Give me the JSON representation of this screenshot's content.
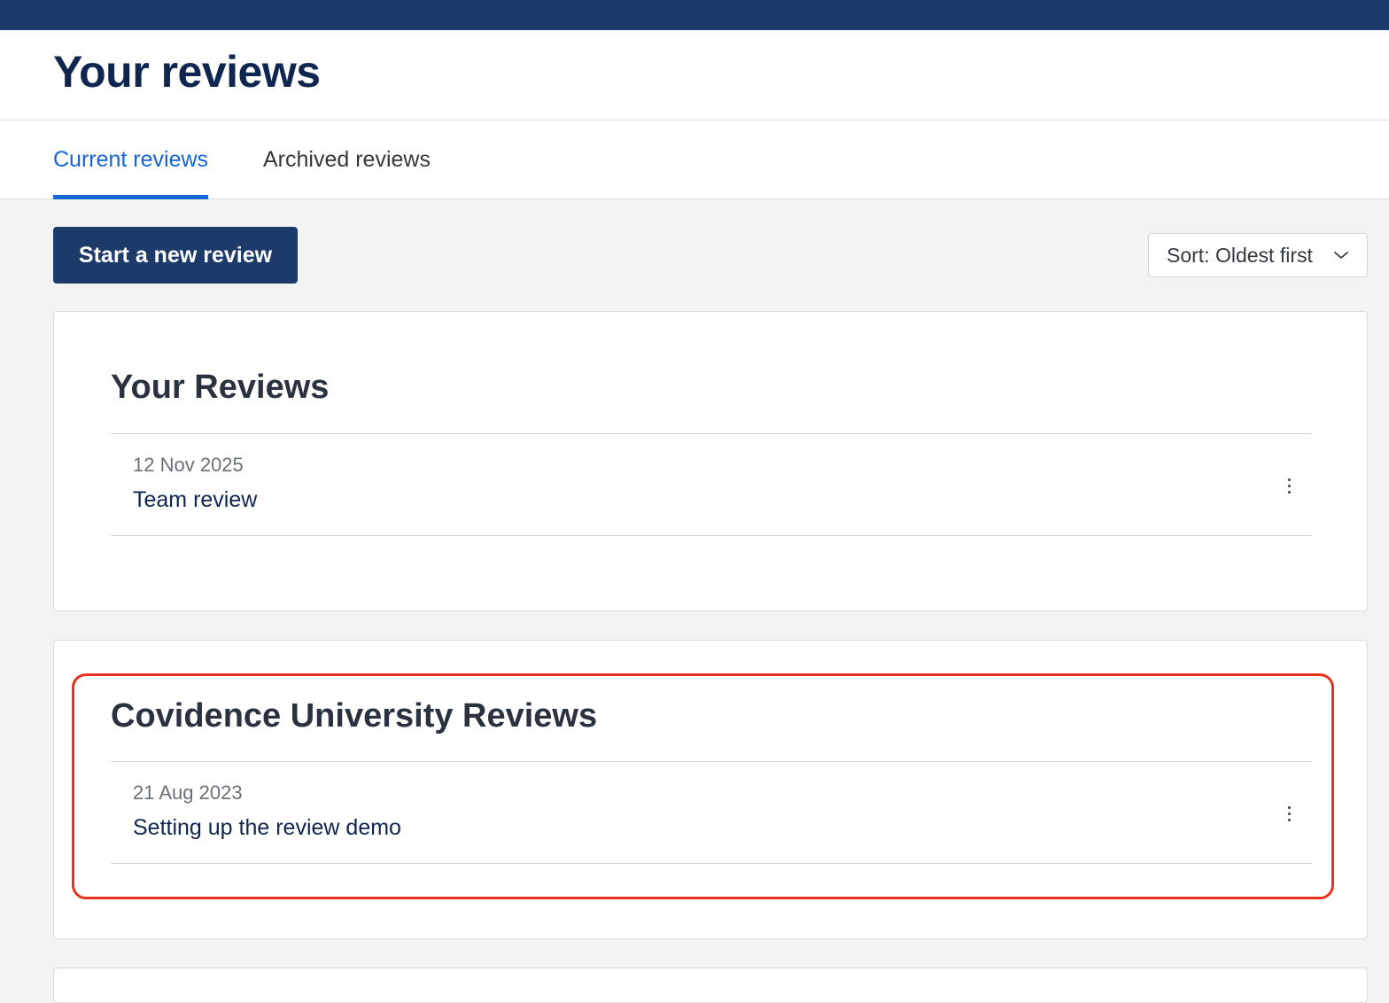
{
  "header": {
    "title": "Your reviews"
  },
  "tabs": [
    {
      "label": "Current reviews",
      "active": true
    },
    {
      "label": "Archived reviews",
      "active": false
    }
  ],
  "toolbar": {
    "new_review_label": "Start a new review",
    "sort_label": "Sort: Oldest first"
  },
  "groups": [
    {
      "title": "Your Reviews",
      "reviews": [
        {
          "date": "12 Nov 2025",
          "name": "Team review"
        }
      ]
    },
    {
      "title": "Covidence University Reviews",
      "highlighted": true,
      "reviews": [
        {
          "date": "21 Aug 2023",
          "name": "Setting up the review demo"
        }
      ]
    }
  ],
  "icons": {
    "sort_chevron": "chevron-down-icon",
    "review_menu": "kebab-menu-icon"
  },
  "colors": {
    "brand_navy": "#1c3a6a",
    "accent_blue": "#1565d8",
    "highlight_red": "#e8321f"
  }
}
